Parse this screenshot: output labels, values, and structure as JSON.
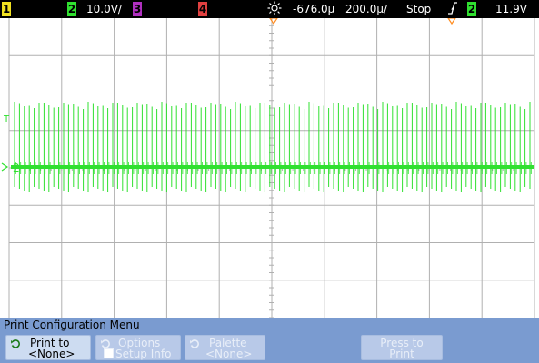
{
  "status_bar": {
    "ch1_num": "1",
    "ch2_num": "2",
    "ch2_scale": "10.0V/",
    "ch3_num": "3",
    "ch4_num": "4",
    "delay": "-676.0µ",
    "timebase": "200.0µ/",
    "run_state": "Stop",
    "trigger_source": "2",
    "trigger_level": "11.9V"
  },
  "colors": {
    "ch1": "#f0e020",
    "ch2": "#30e030",
    "ch3": "#b030c0",
    "ch4": "#e04040",
    "marker": "#ff8c20",
    "grid": "#b0b0b0",
    "menu_bg": "#7a9bd0"
  },
  "icons": {
    "trigger_time": "sun-icon",
    "trigger_edge": "rising-edge-icon",
    "softkey": "rotate-knob-icon"
  },
  "screen": {
    "ch2_marker": "2",
    "trigger_marker": "T"
  },
  "menu": {
    "title": "Print Configuration Menu"
  },
  "softkeys": {
    "print_to": {
      "line1": "Print to",
      "line2": "<None>"
    },
    "options": {
      "line1": "Options",
      "line2": "Setup Info"
    },
    "palette": {
      "line1": "Palette",
      "line2": "<None>"
    },
    "press_to_print": {
      "line1": "Press to",
      "line2": "Print"
    }
  }
}
